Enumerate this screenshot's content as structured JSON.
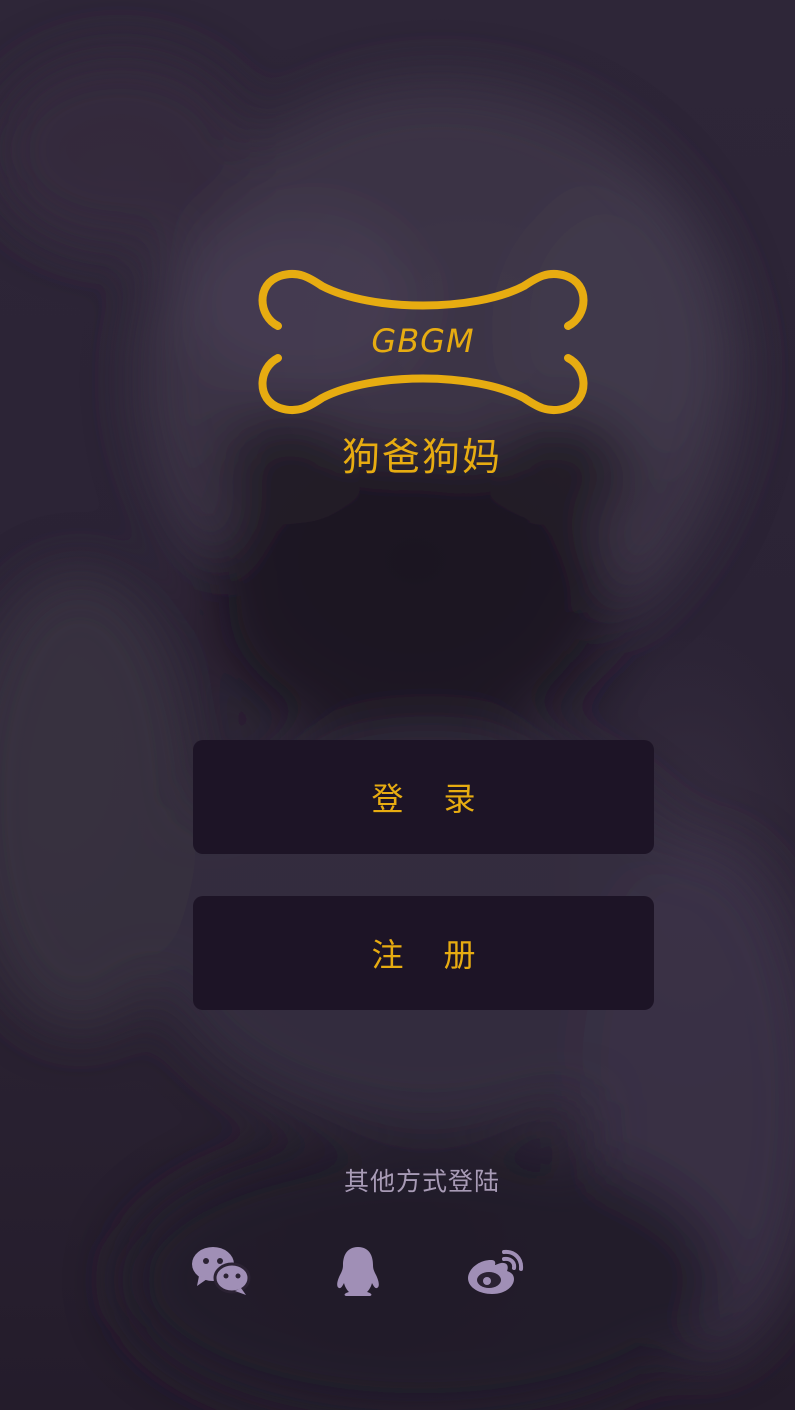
{
  "logo": {
    "text": "GBGM"
  },
  "app": {
    "subtitle": "狗爸狗妈"
  },
  "buttons": {
    "login_label": "登录",
    "register_label": "注册"
  },
  "social_login": {
    "label": "其他方式登陆",
    "options": [
      {
        "name": "WeChat",
        "icon": "wechat-icon"
      },
      {
        "name": "QQ",
        "icon": "qq-icon"
      },
      {
        "name": "Weibo",
        "icon": "weibo-icon"
      }
    ]
  },
  "colors": {
    "accent": "#e7ac11",
    "button_bg": "#1d1426",
    "icon": "#a08fb6",
    "muted_text": "#a89bb6"
  }
}
